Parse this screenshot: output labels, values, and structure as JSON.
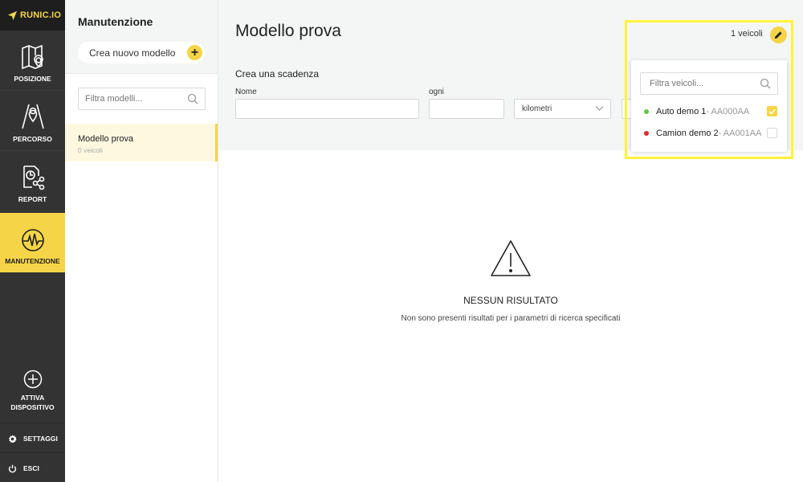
{
  "nav": {
    "logo_text": "RUNIC.IO",
    "items": [
      {
        "label": "POSIZIONE",
        "icon": "map-pin-icon"
      },
      {
        "label": "PERCORSO",
        "icon": "route-icon"
      },
      {
        "label": "REPORT",
        "icon": "report-icon"
      },
      {
        "label": "MANUTENZIONE",
        "icon": "maintenance-pulse-icon"
      }
    ],
    "activate_line1": "ATTIVA",
    "activate_line2": "DISPOSITIVO",
    "settings_label": "SETTAGGI",
    "logout_label": "ESCI",
    "accent_color": "#f5d547"
  },
  "models": {
    "title": "Manutenzione",
    "create_label": "Crea nuovo modello",
    "filter_placeholder": "Filtra modelli...",
    "items": [
      {
        "name": "Modello prova",
        "vehicles": "0 veicoli"
      }
    ]
  },
  "main": {
    "title": "Modello prova",
    "section_label": "Crea una scadenza",
    "name_label": "Nome",
    "name_value": "",
    "every_label": "ogni",
    "every_value": "",
    "unit_selected": "kilometri",
    "vehicle_count": "1 veicoli"
  },
  "vehicle_dropdown": {
    "filter_placeholder": "Filtra veicoli...",
    "vehicles": [
      {
        "name": "Auto demo 1",
        "plate": " - AA000AA",
        "status_color": "#5cc83c",
        "checked": true
      },
      {
        "name": "Camion demo 2",
        "plate": " - AA001AA",
        "status_color": "#e8262b",
        "checked": false
      }
    ]
  },
  "empty_state": {
    "title": "NESSUN RISULTATO",
    "text": "Non sono presenti risultati per i parametri di ricerca specificati"
  }
}
